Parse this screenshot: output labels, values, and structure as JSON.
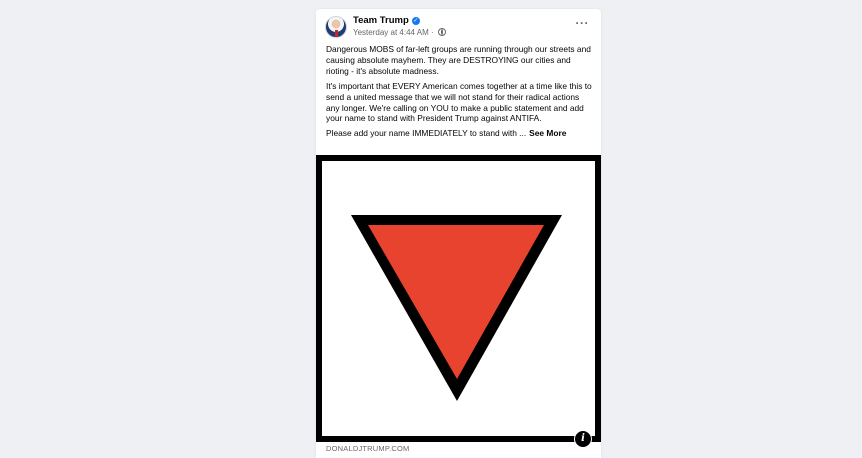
{
  "post": {
    "page_name": "Team Trump",
    "verified_icon": "verified-badge-icon",
    "time": "Yesterday at 4:44 AM · ",
    "privacy_icon": "globe-icon",
    "more_label": "···",
    "paragraphs": [
      "Dangerous MOBS of far-left groups are running through our streets and causing absolute mayhem. They are DESTROYING our cities and rioting - it's absolute madness.",
      "It's important that EVERY American comes together at a time like this to send a united message that we will not stand for their radical actions any longer. We're calling on YOU to make a public statement and add your name to stand with President Trump against ANTIFA.",
      "Please add your name IMMEDIATELY to stand with ..."
    ],
    "see_more_label": "See More",
    "image": {
      "description_icon": "red-inverted-triangle",
      "triangle_fill": "#e8432f",
      "triangle_outline": "#000000",
      "frame_color": "#000000"
    },
    "info_icon_label": "i",
    "link_domain": "DONALDJTRUMP.COM"
  },
  "colors": {
    "background": "#eef0f3",
    "card": "#ffffff",
    "secondary_text": "#65676b",
    "verified": "#1877f2"
  }
}
